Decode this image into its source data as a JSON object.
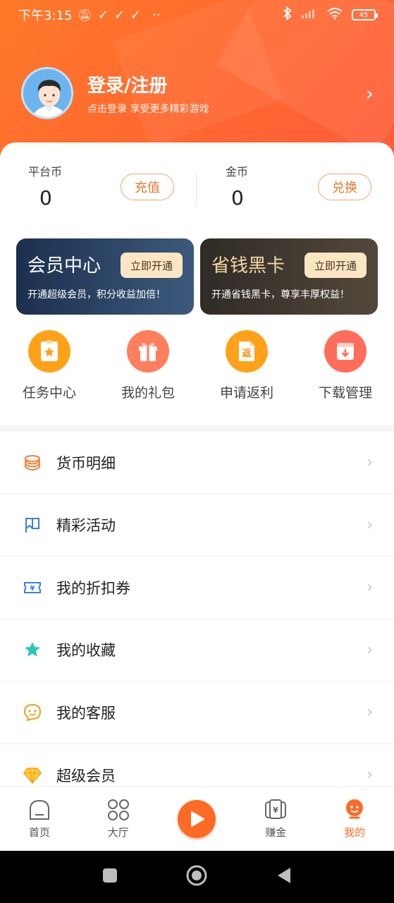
{
  "status_bar": {
    "time": "下午3:15",
    "battery": "45"
  },
  "profile": {
    "title": "登录/注册",
    "subtitle": "点击登录  享受更多精彩游戏"
  },
  "wallet": {
    "platform_label": "平台币",
    "platform_value": "0",
    "recharge_label": "充值",
    "gold_label": "金币",
    "gold_value": "0",
    "exchange_label": "兑换"
  },
  "promos": [
    {
      "title": "会员中心",
      "button": "立即开通",
      "subtitle": "开通超级会员，积分收益加倍！"
    },
    {
      "title": "省钱黑卡",
      "button": "立即开通",
      "subtitle": "开通省钱黑卡，尊享丰厚权益！"
    }
  ],
  "quick_actions": [
    {
      "label": "任务中心",
      "icon": "task-star-icon"
    },
    {
      "label": "我的礼包",
      "icon": "gift-icon"
    },
    {
      "label": "申请返利",
      "icon": "rebate-doc-icon"
    },
    {
      "label": "下载管理",
      "icon": "download-icon"
    }
  ],
  "menu": [
    {
      "label": "货币明细",
      "icon": "coins-stack-icon"
    },
    {
      "label": "精彩活动",
      "icon": "flag-icon"
    },
    {
      "label": "我的折扣券",
      "icon": "coupon-icon"
    },
    {
      "label": "我的收藏",
      "icon": "star-icon"
    },
    {
      "label": "我的客服",
      "icon": "chat-smile-icon"
    },
    {
      "label": "超级会员",
      "icon": "diamond-icon"
    }
  ],
  "tabs": [
    {
      "label": "首页",
      "icon": "home-icon"
    },
    {
      "label": "大厅",
      "icon": "grid-icon"
    },
    {
      "label": "",
      "icon": "play-icon"
    },
    {
      "label": "赚金",
      "icon": "money-card-icon"
    },
    {
      "label": "我的",
      "icon": "profile-face-icon"
    }
  ],
  "colors": {
    "accent": "#ff6a25",
    "header_gradient_start": "#ff7a2a",
    "vip_card": "#1d2f4e",
    "black_card": "#2f2b26"
  }
}
